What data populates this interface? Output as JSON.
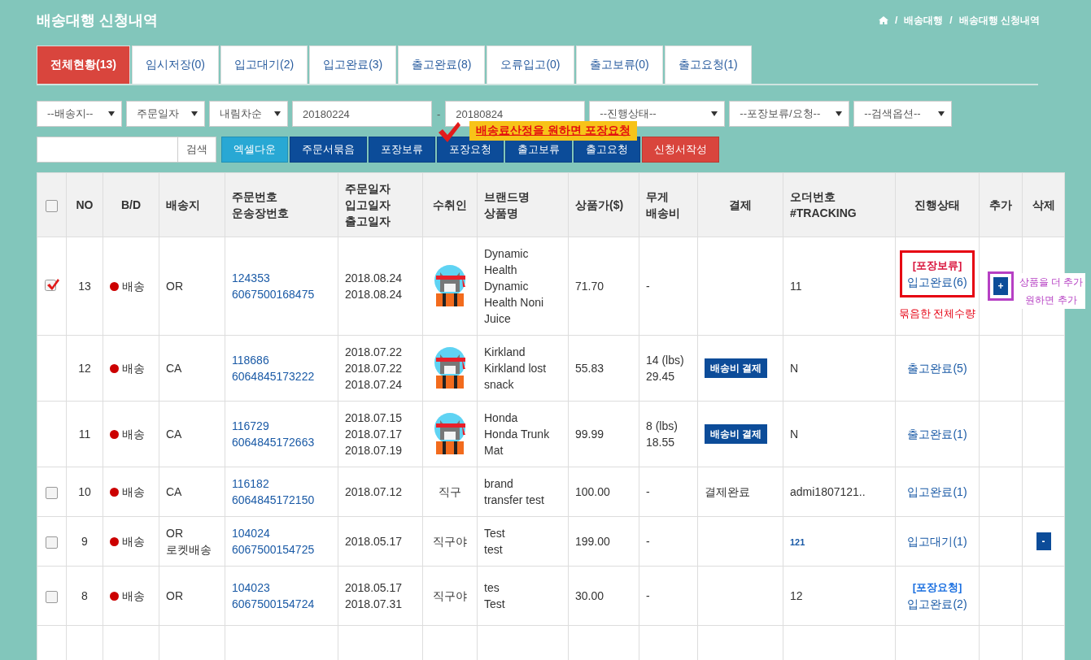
{
  "page_title": "배송대행 신청내역",
  "breadcrumb": [
    {
      "separator": "/",
      "label": "배송대행"
    },
    {
      "separator": "/",
      "label": "배송대행 신청내역"
    }
  ],
  "tabs": [
    {
      "label": "전체현황(13)",
      "selected": true
    },
    {
      "label": "임시저장(0)",
      "selected": false
    },
    {
      "label": "입고대기(2)",
      "selected": false
    },
    {
      "label": "입고완료(3)",
      "selected": false
    },
    {
      "label": "출고완료(8)",
      "selected": false
    },
    {
      "label": "오류입고(0)",
      "selected": false
    },
    {
      "label": "출고보류(0)",
      "selected": false
    },
    {
      "label": "출고요청(1)",
      "selected": false
    }
  ],
  "filters": [
    {
      "kind": "select",
      "value": "--배송지--"
    },
    {
      "kind": "select",
      "value": "주문일자"
    },
    {
      "kind": "select",
      "value": "내림차순"
    },
    {
      "kind": "date",
      "value": "20180224"
    },
    {
      "kind": "dash",
      "value": "-"
    },
    {
      "kind": "date",
      "value": "20180824"
    },
    {
      "kind": "select",
      "value": "--진행상태--"
    },
    {
      "kind": "select",
      "value": "--포장보류/요청--"
    },
    {
      "kind": "select",
      "value": "--검색옵션--"
    }
  ],
  "search": {
    "button": "검색"
  },
  "actions": [
    {
      "label": "엑셀다운",
      "kind": "excel"
    },
    {
      "label": "주문서묶음",
      "kind": "primary"
    },
    {
      "label": "포장보류",
      "kind": "primary"
    },
    {
      "label": "포장요청",
      "kind": "primary"
    },
    {
      "label": "출고보류",
      "kind": "primary"
    },
    {
      "label": "출고요청",
      "kind": "primary"
    },
    {
      "label": "신청서작성",
      "kind": "danger"
    }
  ],
  "callout": {
    "text": "배송료산정을 원하면 포장요청"
  },
  "table": {
    "header_checked": false,
    "columns": [
      [
        "NO"
      ],
      [
        "B/D"
      ],
      [
        "배송지"
      ],
      [
        "주문번호",
        "운송장번호"
      ],
      [
        "주문일자",
        "입고일자",
        "출고일자"
      ],
      [
        "수취인"
      ],
      [
        "브랜드명",
        "상품명"
      ],
      [
        "상품가($)"
      ],
      [
        "무게",
        "배송비"
      ],
      [
        "결제"
      ],
      [
        "오더번호",
        "#TRACKING"
      ],
      [
        "진행상태"
      ],
      [
        "추가"
      ],
      [
        "삭제"
      ]
    ],
    "rows": [
      {
        "checkbox": {
          "checked": true
        },
        "no": "13",
        "bd": "배송",
        "dest": [
          "OR"
        ],
        "order_no": "124353",
        "invoice": "6067500168475",
        "dates": [
          "2018.08.24",
          "2018.08.24"
        ],
        "recipient": {
          "kind": "avatar"
        },
        "product": [
          "Dynamic Health",
          "Dynamic Health Noni Juice"
        ],
        "price": "71.70",
        "weight": [
          "-"
        ],
        "tracking": {
          "kind": "text",
          "text": "11"
        },
        "status": {
          "tag": {
            "kind": "hold",
            "text": "[포장보류]"
          },
          "link": "입고완료(6)",
          "annotated": true,
          "note": "묶음한 전체수량"
        },
        "add": {
          "label": "+",
          "note": "상품을 더 추가원하면 추가"
        }
      },
      {
        "no": "12",
        "bd": "배송",
        "dest": [
          "CA"
        ],
        "order_no": "118686",
        "invoice": "6064845173222",
        "dates": [
          "2018.07.22",
          "2018.07.22",
          "2018.07.24"
        ],
        "recipient": {
          "kind": "avatar"
        },
        "product": [
          "Kirkland",
          "Kirkland lost snack"
        ],
        "price": "55.83",
        "weight": [
          "14 (lbs)",
          "29.45"
        ],
        "payment": {
          "kind": "button",
          "text": "배송비 결제"
        },
        "tracking": {
          "kind": "text",
          "text": "N"
        },
        "status": {
          "link": "출고완료(5)",
          "annotated": false
        }
      },
      {
        "no": "11",
        "bd": "배송",
        "dest": [
          "CA"
        ],
        "order_no": "116729",
        "invoice": "6064845172663",
        "dates": [
          "2018.07.15",
          "2018.07.17",
          "2018.07.19"
        ],
        "recipient": {
          "kind": "avatar"
        },
        "product": [
          "Honda",
          "Honda Trunk Mat"
        ],
        "price": "99.99",
        "weight": [
          "8 (lbs)",
          "18.55"
        ],
        "payment": {
          "kind": "button",
          "text": "배송비 결제"
        },
        "tracking": {
          "kind": "text",
          "text": "N"
        },
        "status": {
          "link": "출고완료(1)",
          "annotated": false
        }
      },
      {
        "checkbox": {
          "checked": false
        },
        "no": "10",
        "bd": "배송",
        "dest": [
          "CA"
        ],
        "order_no": "116182",
        "invoice": "6064845172150",
        "dates": [
          "2018.07.12"
        ],
        "recipient": {
          "kind": "text",
          "text": "직구"
        },
        "product": [
          "brand",
          "transfer test"
        ],
        "price": "100.00",
        "weight": [
          "-"
        ],
        "payment": {
          "kind": "text",
          "text": "결제완료"
        },
        "tracking": {
          "kind": "text",
          "text": "admi1807121.."
        },
        "status": {
          "link": "입고완료(1)",
          "annotated": false
        }
      },
      {
        "checkbox": {
          "checked": false
        },
        "no": "9",
        "bd": "배송",
        "dest": [
          "OR",
          "로켓배송"
        ],
        "order_no": "104024",
        "invoice": "6067500154725",
        "dates": [
          "2018.05.17"
        ],
        "recipient": {
          "kind": "text",
          "text": "직구야"
        },
        "product": [
          "Test",
          "test"
        ],
        "price": "199.00",
        "weight": [
          "-"
        ],
        "tracking": {
          "kind": "link",
          "text": "121"
        },
        "status": {
          "link": "입고대기(1)",
          "annotated": false
        },
        "delete": {
          "label": "-"
        }
      },
      {
        "checkbox": {
          "checked": false
        },
        "no": "8",
        "bd": "배송",
        "dest": [
          "OR"
        ],
        "order_no": "104023",
        "invoice": "6067500154724",
        "dates": [
          "2018.05.17",
          "2018.07.31"
        ],
        "recipient": {
          "kind": "text",
          "text": "직구야"
        },
        "product": [
          "tes",
          "Test"
        ],
        "price": "30.00",
        "weight": [
          "-"
        ],
        "tracking": {
          "kind": "text",
          "text": "12"
        },
        "status": {
          "tag": {
            "kind": "request",
            "text": "[포장요청]"
          },
          "link": "입고완료(2)",
          "annotated": false
        }
      }
    ]
  }
}
